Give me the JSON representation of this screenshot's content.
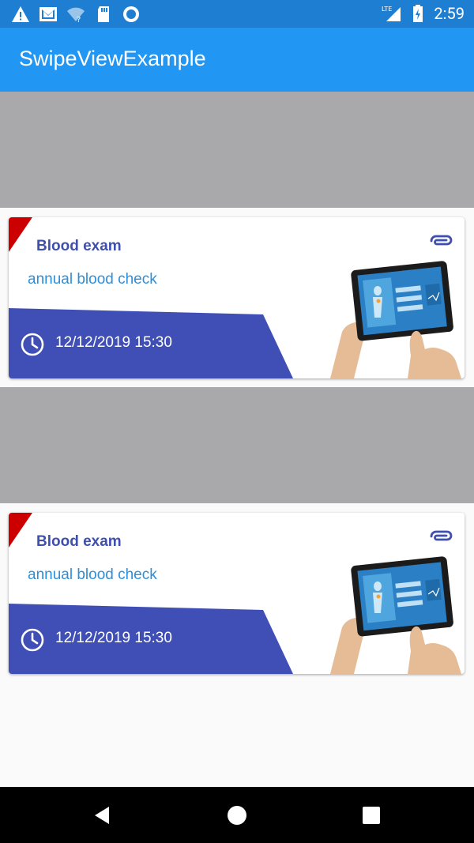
{
  "status_bar": {
    "time": "2:59",
    "network": "LTE",
    "left_icons": [
      "warning-icon",
      "mail-icon",
      "wifi-unknown-icon",
      "sd-card-icon",
      "record-icon"
    ],
    "right_icons": [
      "lte-signal-icon",
      "battery-charging-icon"
    ]
  },
  "app_bar": {
    "title": "SwipeViewExample"
  },
  "cards": [
    {
      "title": "Blood exam",
      "subtitle": "annual blood check",
      "datetime": "12/12/2019 15:30",
      "attachment_icon": "paperclip-icon",
      "clock_icon": "clock-icon"
    },
    {
      "title": "Blood exam",
      "subtitle": "annual blood check",
      "datetime": "12/12/2019 15:30",
      "attachment_icon": "paperclip-icon",
      "clock_icon": "clock-icon"
    }
  ],
  "colors": {
    "status_bar": "#1e7fd2",
    "app_bar": "#2196f3",
    "swipe_background": "#a9a8ab",
    "card_title": "#3f4faf",
    "card_subtitle": "#2d8fd8",
    "band": "#3f4fb5",
    "ribbon": "#cc0000"
  },
  "nav_bar": {
    "buttons": [
      "back-icon",
      "home-icon",
      "recents-icon"
    ]
  }
}
